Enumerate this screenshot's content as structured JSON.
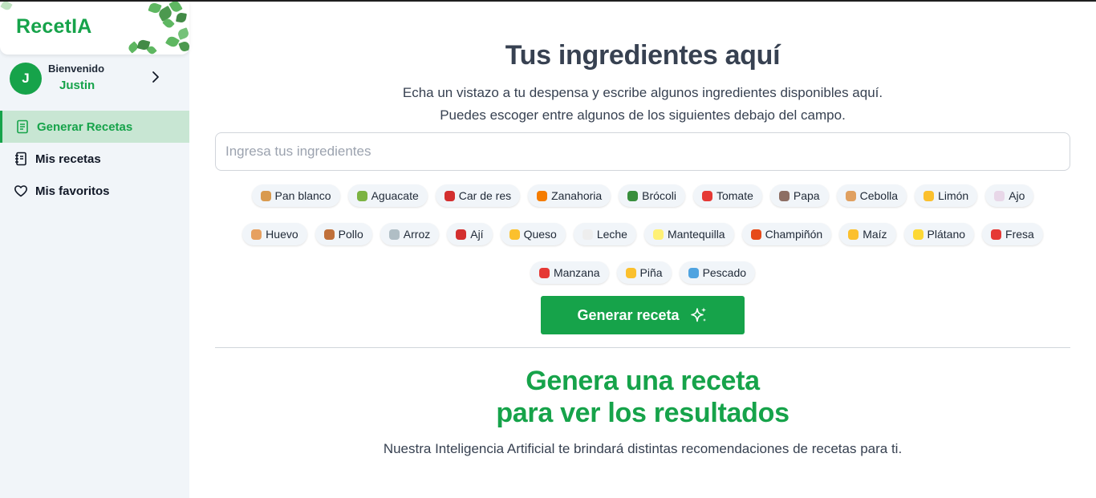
{
  "app": {
    "logo": "RecetIA",
    "accent": "#16a34a"
  },
  "user": {
    "welcome": "Bienvenido",
    "name": "Justin",
    "initial": "J"
  },
  "nav": [
    {
      "label": "Generar Recetas",
      "icon": "document-icon",
      "active": true
    },
    {
      "label": "Mis recetas",
      "icon": "notebook-icon",
      "active": false
    },
    {
      "label": "Mis favoritos",
      "icon": "heart-icon",
      "active": false
    }
  ],
  "main": {
    "title": "Tus ingredientes aquí",
    "subtitle_1": "Echa un vistazo a tu despensa y escribe algunos ingredientes disponibles aquí.",
    "subtitle_2": "Puedes escoger entre algunos de los siguientes debajo del campo.",
    "search_placeholder": "Ingresa tus ingredientes",
    "search_value": "",
    "generate_label": "Generar receta",
    "result_title_1": "Genera una receta",
    "result_title_2": "para ver los resultados",
    "result_sub": "Nuestra Inteligencia Artificial te brindará distintas recomendaciones de recetas para ti."
  },
  "chips": [
    [
      {
        "label": "Pan blanco",
        "icon": "bread-icon",
        "color": "#d99a4e"
      },
      {
        "label": "Aguacate",
        "icon": "avocado-icon",
        "color": "#7cb342"
      },
      {
        "label": "Car de res",
        "icon": "meat-icon",
        "color": "#d32f2f"
      },
      {
        "label": "Zanahoria",
        "icon": "carrot-icon",
        "color": "#f57c00"
      },
      {
        "label": "Brócoli",
        "icon": "broccoli-icon",
        "color": "#388e3c"
      },
      {
        "label": "Tomate",
        "icon": "tomato-icon",
        "color": "#e53935"
      },
      {
        "label": "Papa",
        "icon": "potato-icon",
        "color": "#8d6e63"
      },
      {
        "label": "Cebolla",
        "icon": "onion-icon",
        "color": "#e0a060"
      },
      {
        "label": "Limón",
        "icon": "lemon-icon",
        "color": "#fbc02d"
      },
      {
        "label": "Ajo",
        "icon": "garlic-icon",
        "color": "#e8d7e8"
      }
    ],
    [
      {
        "label": "Huevo",
        "icon": "egg-icon",
        "color": "#e6a060"
      },
      {
        "label": "Pollo",
        "icon": "chicken-leg-icon",
        "color": "#c0703a"
      },
      {
        "label": "Arroz",
        "icon": "rice-icon",
        "color": "#b0bec5"
      },
      {
        "label": "Ají",
        "icon": "chili-icon",
        "color": "#d32f2f"
      },
      {
        "label": "Queso",
        "icon": "cheese-icon",
        "color": "#fbc02d"
      },
      {
        "label": "Leche",
        "icon": "milk-icon",
        "color": "#eeeeee"
      },
      {
        "label": "Mantequilla",
        "icon": "butter-icon",
        "color": "#fff176"
      },
      {
        "label": "Champiñón",
        "icon": "mushroom-icon",
        "color": "#e64a19"
      },
      {
        "label": "Maíz",
        "icon": "corn-icon",
        "color": "#fbc02d"
      },
      {
        "label": "Plátano",
        "icon": "banana-icon",
        "color": "#fdd835"
      },
      {
        "label": "Fresa",
        "icon": "strawberry-icon",
        "color": "#e53935"
      }
    ],
    [
      {
        "label": "Manzana",
        "icon": "apple-icon",
        "color": "#e53935"
      },
      {
        "label": "Piña",
        "icon": "pineapple-icon",
        "color": "#fbc02d"
      },
      {
        "label": "Pescado",
        "icon": "fish-icon",
        "color": "#4fa3e0"
      }
    ]
  ]
}
